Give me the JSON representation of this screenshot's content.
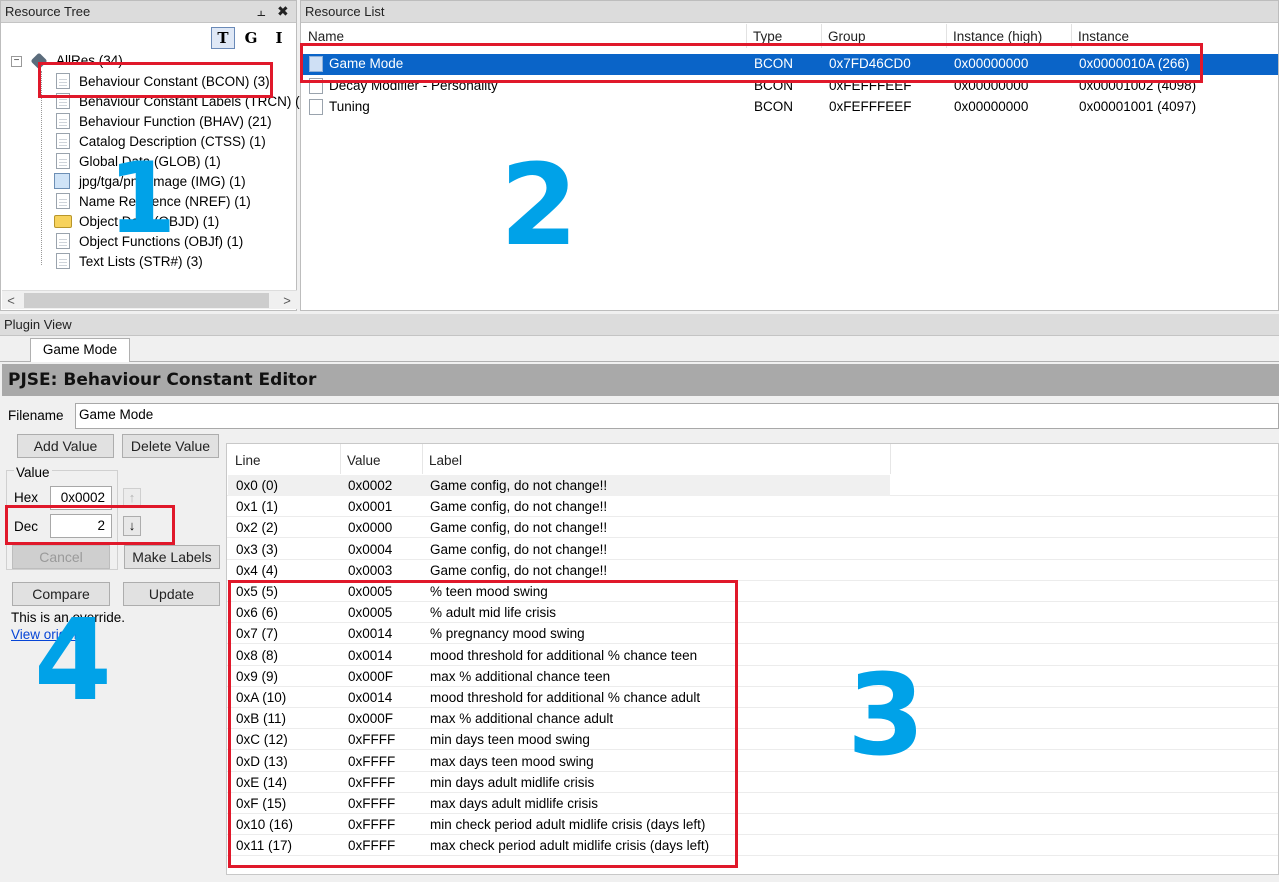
{
  "tree": {
    "title": "Resource Tree",
    "pin_glyph": "⫠",
    "close_glyph": "✖",
    "buttons": [
      "T",
      "G",
      "I"
    ],
    "root": "AllRes (34)",
    "items": [
      "Behaviour Constant (BCON) (3)",
      "Behaviour Constant Labels (TRCN) (",
      "Behaviour Function (BHAV) (21)",
      "Catalog Description (CTSS) (1)",
      "Global Data (GLOB) (1)",
      "jpg/tga/png Image (IMG) (1)",
      "Name Reference (NREF) (1)",
      "Object Data (OBJD) (1)",
      "Object Functions (OBJf) (1)",
      "Text Lists (STR#) (3)"
    ],
    "scroll_left": "<",
    "scroll_right": ">"
  },
  "list": {
    "title": "Resource List",
    "columns": [
      "Name",
      "Type",
      "Group",
      "Instance (high)",
      "Instance"
    ],
    "rows": [
      {
        "name": "Game Mode",
        "type": "BCON",
        "group": "0x7FD46CD0",
        "ihigh": "0x00000000",
        "instance": "0x0000010A (266)"
      },
      {
        "name": "Decay Modifier - Personality",
        "type": "BCON",
        "group": "0xFEFFFEEF",
        "ihigh": "0x00000000",
        "instance": "0x00001002 (4098)"
      },
      {
        "name": "Tuning",
        "type": "BCON",
        "group": "0xFEFFFEEF",
        "ihigh": "0x00000000",
        "instance": "0x00001001 (4097)"
      }
    ]
  },
  "plugin": {
    "title": "Plugin View",
    "tab": "Game Mode",
    "editor_title": "PJSE: Behaviour Constant Editor",
    "filename_label": "Filename",
    "filename_value": "Game Mode",
    "add_value": "Add Value",
    "delete_value": "Delete Value",
    "value_group": "Value",
    "hex_label": "Hex",
    "hex_value": "0x0002",
    "dec_label": "Dec",
    "dec_value": "2",
    "spin_up": "↑",
    "spin_down": "↓",
    "cancel": "Cancel",
    "make_labels": "Make Labels",
    "compare": "Compare",
    "update": "Update",
    "override_text": "This is an override.",
    "view_original": "View original"
  },
  "table": {
    "columns": [
      "Line",
      "Value",
      "Label"
    ],
    "rows": [
      [
        "0x0 (0)",
        "0x0002",
        "Game config, do not change!!"
      ],
      [
        "0x1 (1)",
        "0x0001",
        "Game config, do not change!!"
      ],
      [
        "0x2 (2)",
        "0x0000",
        "Game config, do not change!!"
      ],
      [
        "0x3 (3)",
        "0x0004",
        "Game config, do not change!!"
      ],
      [
        "0x4 (4)",
        "0x0003",
        "Game config, do not change!!"
      ],
      [
        "0x5 (5)",
        "0x0005",
        "% teen mood swing"
      ],
      [
        "0x6 (6)",
        "0x0005",
        "% adult mid life crisis"
      ],
      [
        "0x7 (7)",
        "0x0014",
        "% pregnancy mood swing"
      ],
      [
        "0x8 (8)",
        "0x0014",
        "mood threshold for additional % chance teen"
      ],
      [
        "0x9 (9)",
        "0x000F",
        "max % additional chance teen"
      ],
      [
        "0xA (10)",
        "0x0014",
        "mood threshold for additional % chance adult"
      ],
      [
        "0xB (11)",
        "0x000F",
        "max % additional chance adult"
      ],
      [
        "0xC (12)",
        "0xFFFF",
        "min days teen mood swing"
      ],
      [
        "0xD (13)",
        "0xFFFF",
        "max days teen mood swing"
      ],
      [
        "0xE (14)",
        "0xFFFF",
        "min days adult midlife crisis"
      ],
      [
        "0xF (15)",
        "0xFFFF",
        "max days adult midlife crisis"
      ],
      [
        "0x10 (16)",
        "0xFFFF",
        "min check period adult midlife crisis (days left)"
      ],
      [
        "0x11 (17)",
        "0xFFFF",
        "max check period adult midlife crisis (days left)"
      ]
    ]
  },
  "annotations": [
    "1",
    "2",
    "3",
    "4"
  ],
  "colors": {
    "selection": "#0a64c8",
    "annotation_box": "#e0182a",
    "annotation_number": "#00a2e8"
  }
}
